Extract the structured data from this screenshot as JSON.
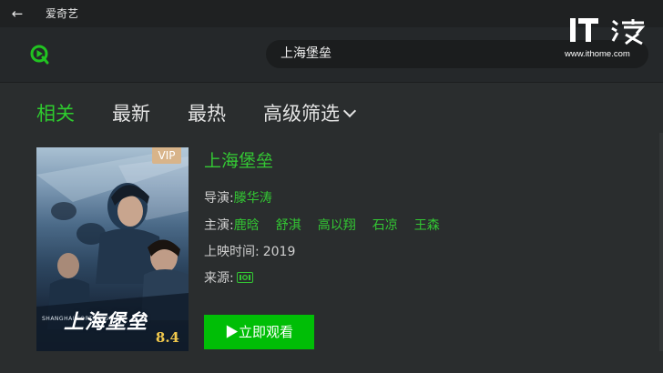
{
  "window": {
    "title": "爱奇艺"
  },
  "search": {
    "value": "上海堡垒"
  },
  "watermark": {
    "logo_text": "IT之家",
    "url": "www.ithome.com"
  },
  "tabs": [
    {
      "label": "相关",
      "active": true
    },
    {
      "label": "最新",
      "active": false
    },
    {
      "label": "最热",
      "active": false
    },
    {
      "label": "高级筛选",
      "active": false
    }
  ],
  "movie": {
    "title": "上海堡垒",
    "poster": {
      "badge": "VIP",
      "rating": "8.4",
      "title_art": "上海堡垒",
      "subtitle_art": "SHANGHAI FORTRESS"
    },
    "director_label": "导演:",
    "director": "滕华涛",
    "cast_label": "主演:",
    "cast": [
      "鹿晗",
      "舒淇",
      "高以翔",
      "石凉",
      "王森"
    ],
    "release_label": "上映时间:",
    "release_year": "2019",
    "source_label": "来源:",
    "source_icon": "iqiyi-source-icon"
  },
  "actions": {
    "watch_label": "▶立即观看"
  },
  "colors": {
    "accent": "#2ecc2e",
    "button": "#00be06",
    "background": "#2a2d2e"
  }
}
